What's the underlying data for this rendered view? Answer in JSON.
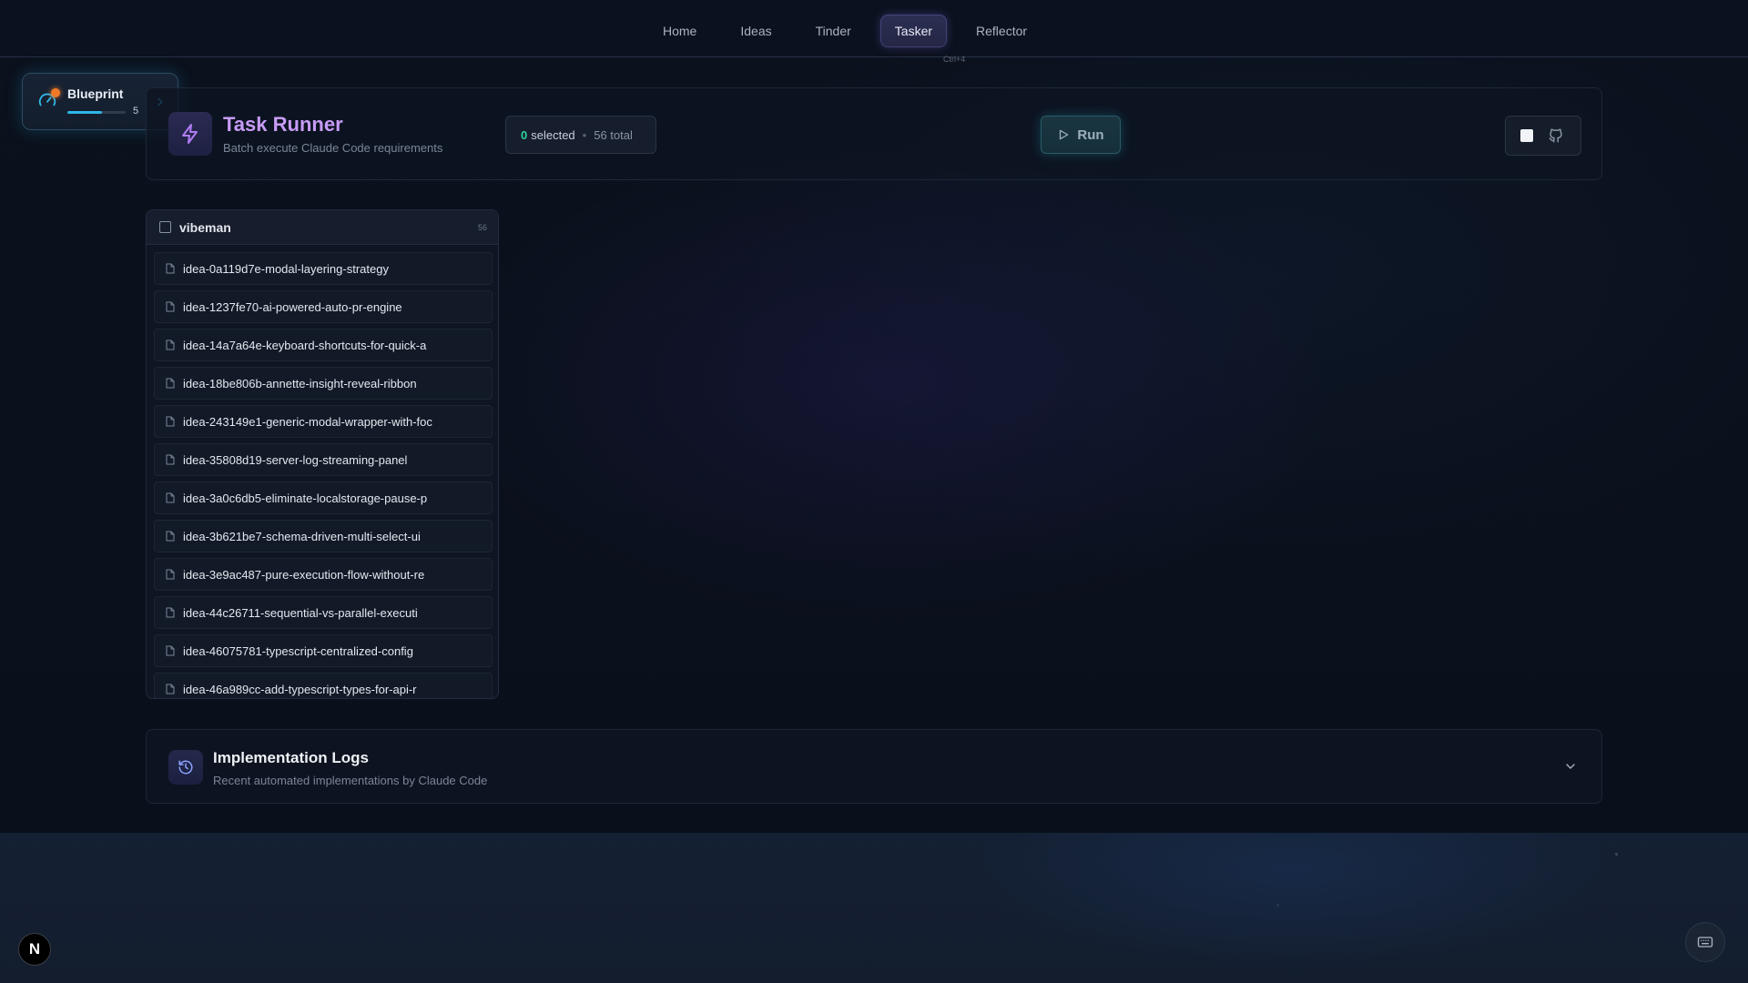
{
  "nav": {
    "items": [
      {
        "label": "Home",
        "active": false
      },
      {
        "label": "Ideas",
        "active": false
      },
      {
        "label": "Tinder",
        "active": false
      },
      {
        "label": "Tasker",
        "active": true
      },
      {
        "label": "Reflector",
        "active": false
      }
    ],
    "hint": "Ctrl+4"
  },
  "blueprint": {
    "title": "Blueprint",
    "count": "5",
    "progress": 0.6,
    "accent": "#2fb7e8",
    "status_color": "#f07a28"
  },
  "runner": {
    "title": "Task Runner",
    "subtitle": "Batch execute Claude Code requirements",
    "selected_count": "0",
    "selected_label": "selected",
    "separator": "•",
    "total_label": "56 total",
    "run_label": "Run",
    "title_color": "#c89cf7",
    "selected_color": "#2fd19b"
  },
  "project": {
    "name": "vibeman",
    "count": "56",
    "requirements": [
      "idea-0a119d7e-modal-layering-strategy",
      "idea-1237fe70-ai-powered-auto-pr-engine",
      "idea-14a7a64e-keyboard-shortcuts-for-quick-a",
      "idea-18be806b-annette-insight-reveal-ribbon",
      "idea-243149e1-generic-modal-wrapper-with-foc",
      "idea-35808d19-server-log-streaming-panel",
      "idea-3a0c6db5-eliminate-localstorage-pause-p",
      "idea-3b621be7-schema-driven-multi-select-ui",
      "idea-3e9ac487-pure-execution-flow-without-re",
      "idea-44c26711-sequential-vs-parallel-executi",
      "idea-46075781-typescript-centralized-config",
      "idea-46a989cc-add-typescript-types-for-api-r"
    ]
  },
  "logs": {
    "title": "Implementation Logs",
    "subtitle": "Recent automated implementations by Claude Code"
  },
  "corner": {
    "next_badge": "N"
  },
  "icons": {
    "runner": "lightning-icon",
    "logs": "history-icon",
    "stop": "stop-icon",
    "git": "git-commit-icon",
    "keyboard": "keyboard-icon",
    "requirement": "file-icon",
    "blueprint": "gauge-icon"
  }
}
